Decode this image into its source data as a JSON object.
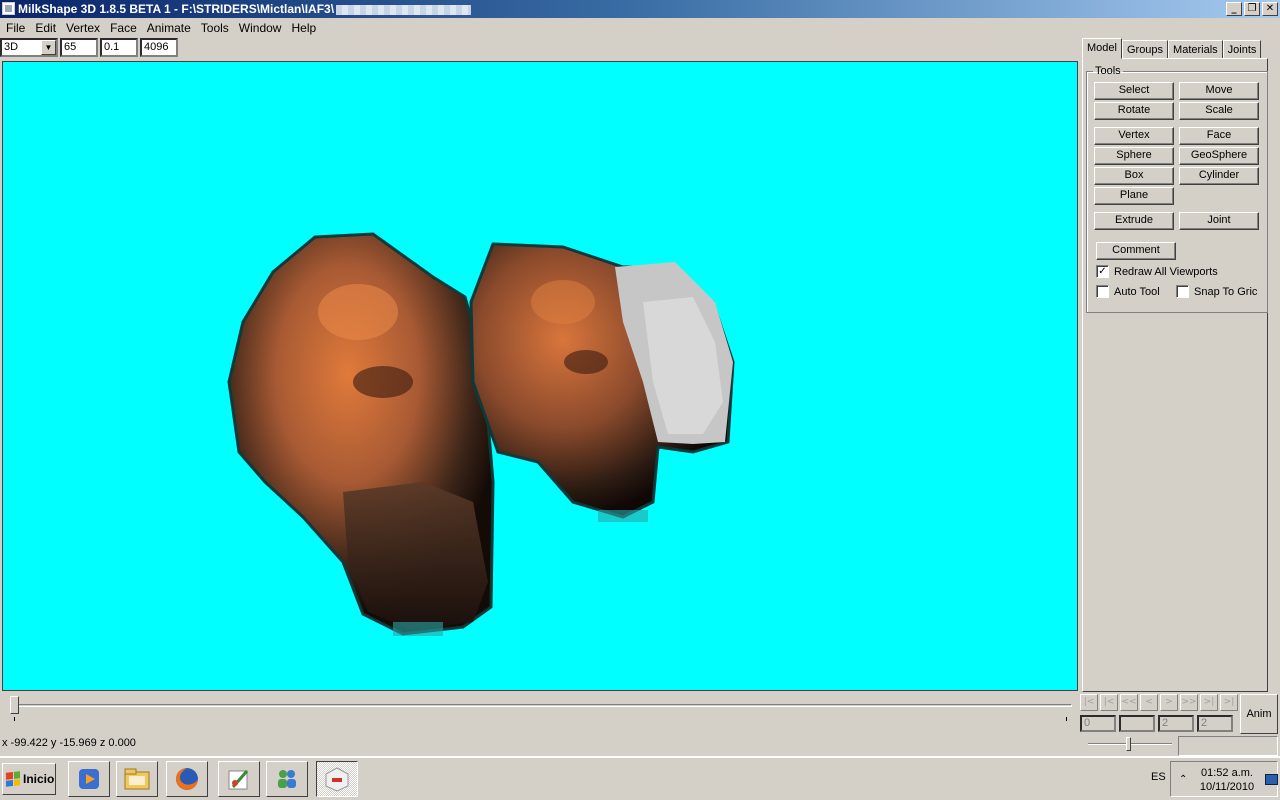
{
  "window": {
    "title": "MilkShape 3D 1.8.5 BETA 1 - F:\\STRIDERS\\Mictlan\\IAF3\\",
    "minimize": "_",
    "restore": "❐",
    "close": "✕"
  },
  "menu": [
    "File",
    "Edit",
    "Vertex",
    "Face",
    "Animate",
    "Tools",
    "Window",
    "Help"
  ],
  "toolbar": {
    "view_mode": "3D",
    "fov": "65",
    "near_clip": "0.1",
    "far_clip": "4096"
  },
  "viewport": {
    "background_color": "#00ffff"
  },
  "panel": {
    "tabs": [
      "Model",
      "Groups",
      "Materials",
      "Joints"
    ],
    "active_tab": "Model",
    "tools_legend": "Tools",
    "buttons": {
      "select": "Select",
      "move": "Move",
      "rotate": "Rotate",
      "scale": "Scale",
      "vertex": "Vertex",
      "face": "Face",
      "sphere": "Sphere",
      "geosphere": "GeoSphere",
      "box": "Box",
      "cylinder": "Cylinder",
      "plane": "Plane",
      "extrude": "Extrude",
      "joint": "Joint",
      "comment": "Comment"
    },
    "checks": {
      "redraw_all": {
        "label": "Redraw All Viewports",
        "checked": true
      },
      "auto_tool": {
        "label": "Auto Tool",
        "checked": false
      },
      "snap_to_grid": {
        "label": "Snap To Gric",
        "checked": false
      }
    }
  },
  "animation": {
    "nav": [
      "|<",
      "|<",
      "<<",
      "<",
      ">",
      ">>",
      ">|",
      ">|"
    ],
    "frames": [
      "0",
      "",
      "2",
      "2"
    ],
    "anim_label": "Anim"
  },
  "status": {
    "coords": "x -99.422 y -15.969 z 0.000"
  },
  "taskbar": {
    "start_label": "Inicio",
    "language": "ES",
    "time": "01:52 a.m.",
    "date": "10/11/2010",
    "tray_chevron": "⌃",
    "apps": [
      "media-player-icon",
      "folder-icon",
      "firefox-icon",
      "paint-icon",
      "messenger-icon",
      "milkshape-icon"
    ]
  }
}
